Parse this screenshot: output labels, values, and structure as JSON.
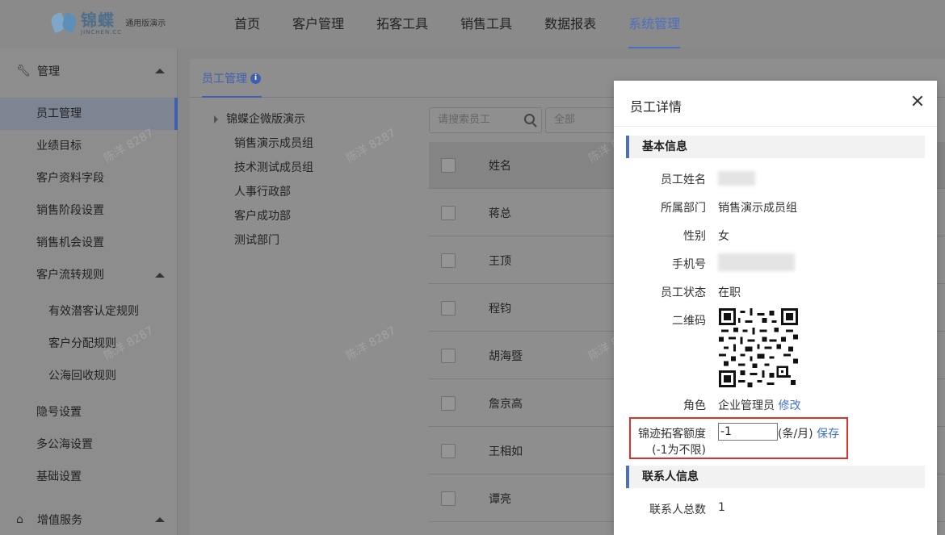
{
  "logo": {
    "name": "锦蝶",
    "en": "JINCHEN.CC",
    "edition": "通用版演示"
  },
  "nav": [
    "首页",
    "客户管理",
    "拓客工具",
    "销售工具",
    "数据报表",
    "系统管理"
  ],
  "nav_active_index": 5,
  "sidebar": {
    "group_manage": "管理",
    "items": [
      "员工管理",
      "业绩目标",
      "客户资料字段",
      "销售阶段设置",
      "销售机会设置",
      "客户流转规则"
    ],
    "sub_items": [
      "有效潜客认定规则",
      "客户分配规则",
      "公海回收规则"
    ],
    "items2": [
      "隐号设置",
      "多公海设置",
      "基础设置"
    ],
    "group_value": "增值服务"
  },
  "main": {
    "title": "员工管理",
    "tree_root": "锦蝶企微版演示",
    "tree_nodes": [
      "销售演示成员组",
      "技术测试成员组",
      "人事行政部",
      "客户成功部",
      "测试部门"
    ],
    "search_placeholder": "请搜索员工",
    "filter_value": "全部",
    "column_name": "姓名",
    "rows": [
      "蒋总",
      "王顶",
      "程钧",
      "胡海暨",
      "詹京高",
      "王相如",
      "谭亮"
    ]
  },
  "watermark": "陈洋 8287",
  "modal": {
    "title": "员工详情",
    "section_basic": "基本信息",
    "label_name": "员工姓名",
    "label_dept": "所属部门",
    "dept": "销售演示成员组",
    "label_gender": "性别",
    "gender": "女",
    "label_phone": "手机号",
    "label_status": "员工状态",
    "status": "在职",
    "label_qr": "二维码",
    "label_role": "角色",
    "role": "企业管理员",
    "role_edit": "修改",
    "label_quota": "锦迹拓客额度",
    "label_quota_hint": "(-1为不限)",
    "quota_value": "-1",
    "quota_unit": "(条/月)",
    "quota_save": "保存",
    "section_contact": "联系人信息",
    "label_contact_total": "联系人总数",
    "contact_total": "1"
  },
  "colors": {
    "accent": "#4d6fc0",
    "highlight_border": "#e0302a",
    "link": "#3f6fd0"
  }
}
